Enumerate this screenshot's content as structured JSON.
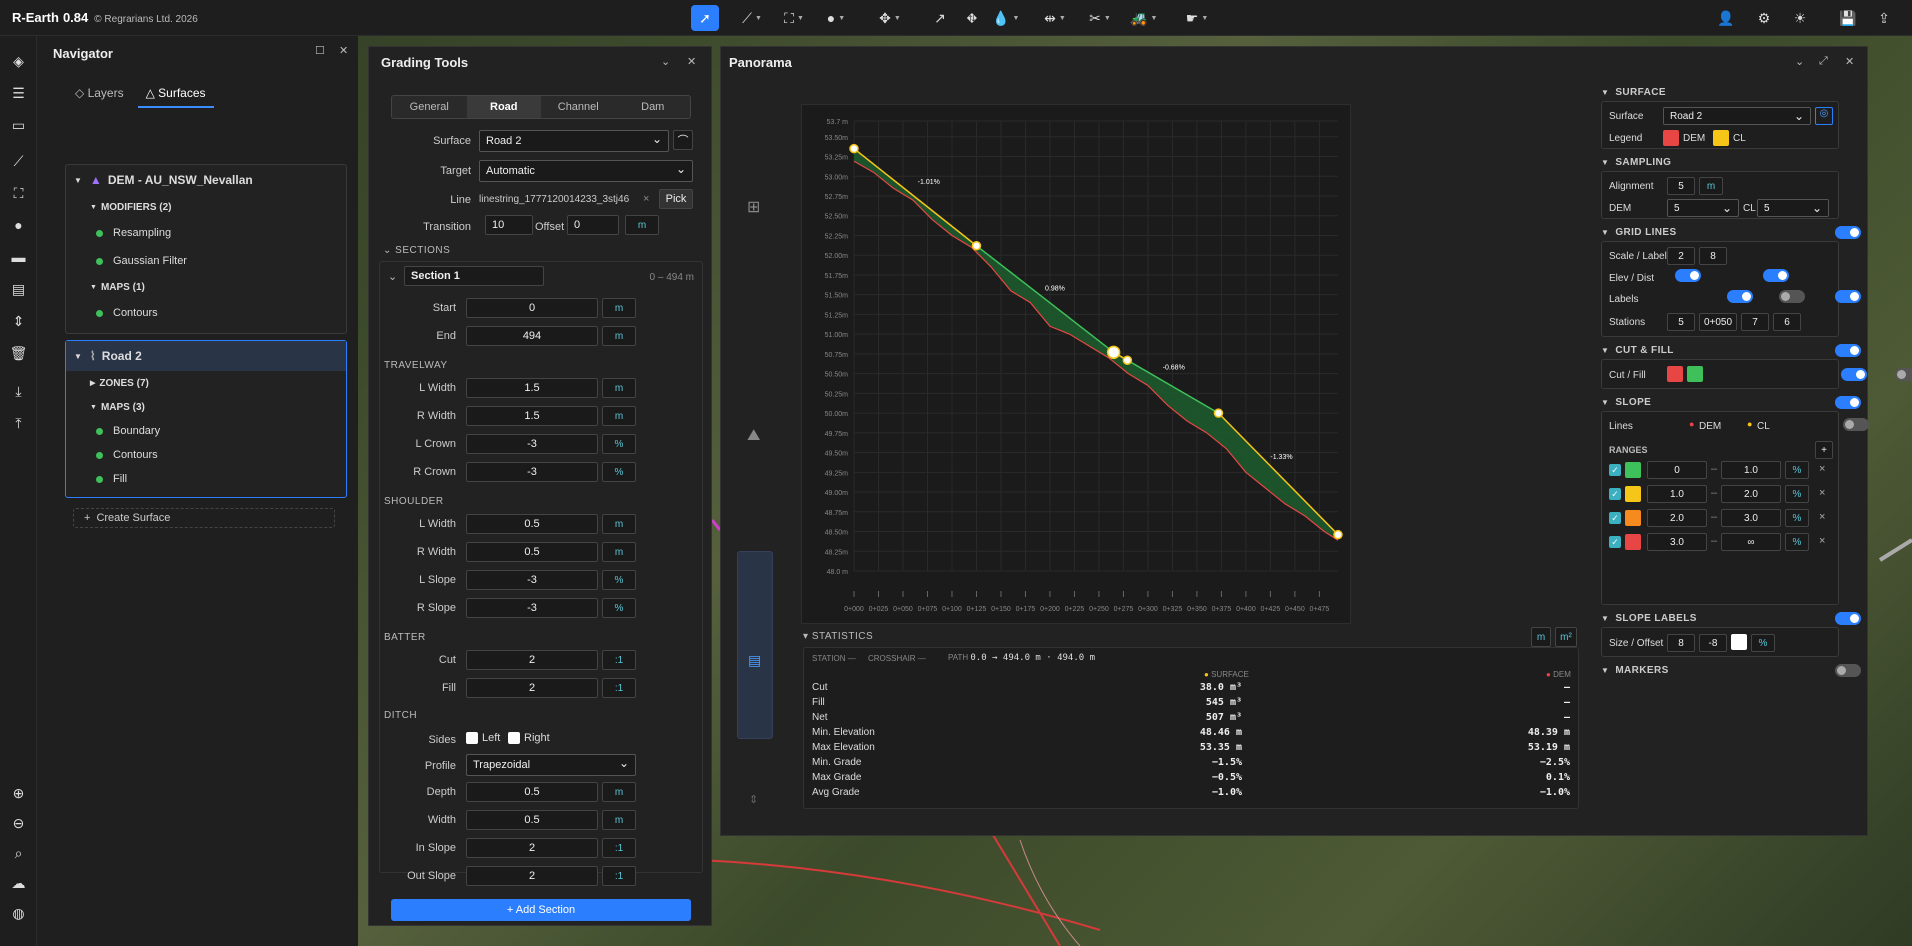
{
  "app": {
    "name": "R-Earth",
    "version": "0.84",
    "copyright": "© Regrarians Ltd. 2026"
  },
  "navigator": {
    "title": "Navigator",
    "tabs": [
      "Layers",
      "Surfaces"
    ],
    "dem": {
      "name": "DEM - AU_NSW_Nevallan",
      "modifiers_label": "MODIFIERS (2)",
      "modifiers": [
        "Resampling",
        "Gaussian Filter"
      ],
      "maps_label": "MAPS (1)",
      "maps": [
        "Contours"
      ]
    },
    "road": {
      "name": "Road 2",
      "zones_label": "ZONES (7)",
      "maps_label": "MAPS (3)",
      "maps": [
        "Boundary",
        "Contours",
        "Fill"
      ]
    },
    "create": "Create Surface"
  },
  "grading": {
    "title": "Grading Tools",
    "tabs": [
      "General",
      "Road",
      "Channel",
      "Dam"
    ],
    "surface_label": "Surface",
    "surface_value": "Road 2",
    "target_label": "Target",
    "target_value": "Automatic",
    "line_label": "Line",
    "line_value": "linestring_1777120014233_3stj46",
    "pick": "Pick",
    "transition_label": "Transition",
    "transition_value": "10",
    "offset_label": "Offset",
    "offset_value": "0",
    "m": "m",
    "sections_label": "SECTIONS",
    "section_name": "Section 1",
    "section_range": "0 – 494 m",
    "start_label": "Start",
    "start_value": "0",
    "end_label": "End",
    "end_value": "494",
    "travelway_label": "TRAVELWAY",
    "travelway": [
      {
        "l": "L Width",
        "v": "1.5",
        "u": "m"
      },
      {
        "l": "R Width",
        "v": "1.5",
        "u": "m"
      },
      {
        "l": "L Crown",
        "v": "-3",
        "u": "%"
      },
      {
        "l": "R Crown",
        "v": "-3",
        "u": "%"
      }
    ],
    "shoulder_label": "SHOULDER",
    "shoulder": [
      {
        "l": "L Width",
        "v": "0.5",
        "u": "m"
      },
      {
        "l": "R Width",
        "v": "0.5",
        "u": "m"
      },
      {
        "l": "L Slope",
        "v": "-3",
        "u": "%"
      },
      {
        "l": "R Slope",
        "v": "-3",
        "u": "%"
      }
    ],
    "batter_label": "BATTER",
    "batter": [
      {
        "l": "Cut",
        "v": "2",
        "u": ":1"
      },
      {
        "l": "Fill",
        "v": "2",
        "u": ":1"
      }
    ],
    "ditch_label": "DITCH",
    "sides_label": "Sides",
    "left": "Left",
    "right": "Right",
    "profile_label": "Profile",
    "profile_value": "Trapezoidal",
    "ditch": [
      {
        "l": "Depth",
        "v": "0.5",
        "u": "m"
      },
      {
        "l": "Width",
        "v": "0.5",
        "u": "m"
      },
      {
        "l": "In Slope",
        "v": "2",
        "u": ":1"
      },
      {
        "l": "Out Slope",
        "v": "2",
        "u": ":1"
      }
    ],
    "add_section": "+ Add Section"
  },
  "panorama": {
    "title": "Panorama",
    "statistics": {
      "label": "STATISTICS",
      "unit1": "m",
      "unit2": "m²",
      "station": "STATION",
      "crosshair": "CROSSHAIR",
      "path_label": "PATH",
      "path_value": "0.0 → 494.0 m · 494.0 m",
      "surface_col": "SURFACE",
      "dem_col": "DEM",
      "rows": [
        {
          "l": "Cut",
          "s": "38.0 m³",
          "d": "—"
        },
        {
          "l": "Fill",
          "s": "545 m³",
          "d": "—"
        },
        {
          "l": "Net",
          "s": "507 m³",
          "d": "—"
        },
        {
          "l": "Min. Elevation",
          "s": "48.46 m",
          "d": "48.39 m"
        },
        {
          "l": "Max Elevation",
          "s": "53.35 m",
          "d": "53.19 m"
        },
        {
          "l": "Min. Grade",
          "s": "−1.5%",
          "d": "−2.5%"
        },
        {
          "l": "Max Grade",
          "s": "−0.5%",
          "d": "0.1%"
        },
        {
          "l": "Avg Grade",
          "s": "−1.0%",
          "d": "−1.0%"
        }
      ]
    },
    "right": {
      "surface_sec": "SURFACE",
      "surface_label": "Surface",
      "surface_value": "Road 2",
      "legend_label": "Legend",
      "legend_dem": "DEM",
      "legend_cl": "CL",
      "sampling_sec": "SAMPLING",
      "alignment_label": "Alignment",
      "alignment_value": "5",
      "alignment_unit": "m",
      "dem_label": "DEM",
      "dem_value": "5",
      "cl_label": "CL",
      "cl_value": "5",
      "grid_sec": "GRID LINES",
      "scale_label": "Scale / Label",
      "scale_a": "2",
      "scale_b": "8",
      "elev_label": "Elev / Dist",
      "labels_label": "Labels",
      "stations_label": "Stations",
      "st_a": "5",
      "st_b": "0+050",
      "st_c": "7",
      "st_d": "6",
      "cutfill_sec": "CUT & FILL",
      "cutfill_label": "Cut / Fill",
      "slope_sec": "SLOPE",
      "lines_label": "Lines",
      "lines_dem": "DEM",
      "lines_cl": "CL",
      "ranges_label": "RANGES",
      "ranges": [
        {
          "color": "#3ec15a",
          "a": "0",
          "b": "1.0",
          "u": "%"
        },
        {
          "color": "#f5c518",
          "a": "1.0",
          "b": "2.0",
          "u": "%"
        },
        {
          "color": "#f58a1f",
          "a": "2.0",
          "b": "3.0",
          "u": "%"
        },
        {
          "color": "#e84545",
          "a": "3.0",
          "b": "∞",
          "u": "%"
        }
      ],
      "slope_labels_sec": "SLOPE LABELS",
      "size_label": "Size / Offset",
      "size_a": "8",
      "size_b": "-8",
      "size_u": "%",
      "markers_sec": "MARKERS"
    }
  },
  "chart_data": {
    "type": "line",
    "xlabel": "",
    "ylabel": "",
    "ylim": [
      48.0,
      53.7
    ],
    "xlim": [
      0,
      494
    ],
    "y_ticks": [
      "53.7 m",
      "53.50m",
      "53.25m",
      "53.00m",
      "52.75m",
      "52.50m",
      "52.25m",
      "52.00m",
      "51.75m",
      "51.50m",
      "51.25m",
      "51.00m",
      "50.75m",
      "50.50m",
      "50.25m",
      "50.00m",
      "49.75m",
      "49.50m",
      "49.25m",
      "49.00m",
      "48.75m",
      "48.50m",
      "48.25m",
      "48.0 m"
    ],
    "x_ticks": [
      "0+000",
      "0+025",
      "0+050",
      "0+075",
      "0+100",
      "0+125",
      "0+150",
      "0+175",
      "0+200",
      "0+225",
      "0+250",
      "0+275",
      "0+300",
      "0+325",
      "0+350",
      "0+375",
      "0+400",
      "0+425",
      "0+450",
      "0+475"
    ],
    "series": [
      {
        "name": "CL",
        "color": "#f5c518",
        "x": [
          0,
          125,
          265,
          279,
          372,
          494
        ],
        "y": [
          53.35,
          52.12,
          50.77,
          50.67,
          50.0,
          48.46
        ]
      },
      {
        "name": "DEM",
        "color": "#e84545",
        "x": [
          0,
          20,
          40,
          60,
          80,
          100,
          120,
          140,
          160,
          180,
          200,
          220,
          240,
          260,
          280,
          300,
          320,
          340,
          360,
          380,
          400,
          420,
          440,
          460,
          480,
          494
        ],
        "y": [
          53.19,
          53.05,
          52.85,
          52.7,
          52.45,
          52.25,
          52.1,
          51.85,
          51.55,
          51.4,
          51.1,
          51.0,
          50.85,
          50.7,
          50.5,
          50.35,
          50.1,
          49.9,
          49.75,
          49.55,
          49.25,
          49.05,
          48.85,
          48.7,
          48.5,
          48.39
        ]
      }
    ],
    "annotations": [
      {
        "x": 65,
        "y": 52.9,
        "text": "-1.01%"
      },
      {
        "x": 195,
        "y": 51.55,
        "text": "0.98%"
      },
      {
        "x": 315,
        "y": 50.55,
        "text": "-0.68%"
      },
      {
        "x": 425,
        "y": 49.42,
        "text": "-1.33%"
      }
    ],
    "vertices": [
      0,
      125,
      265,
      279,
      372,
      494
    ]
  }
}
